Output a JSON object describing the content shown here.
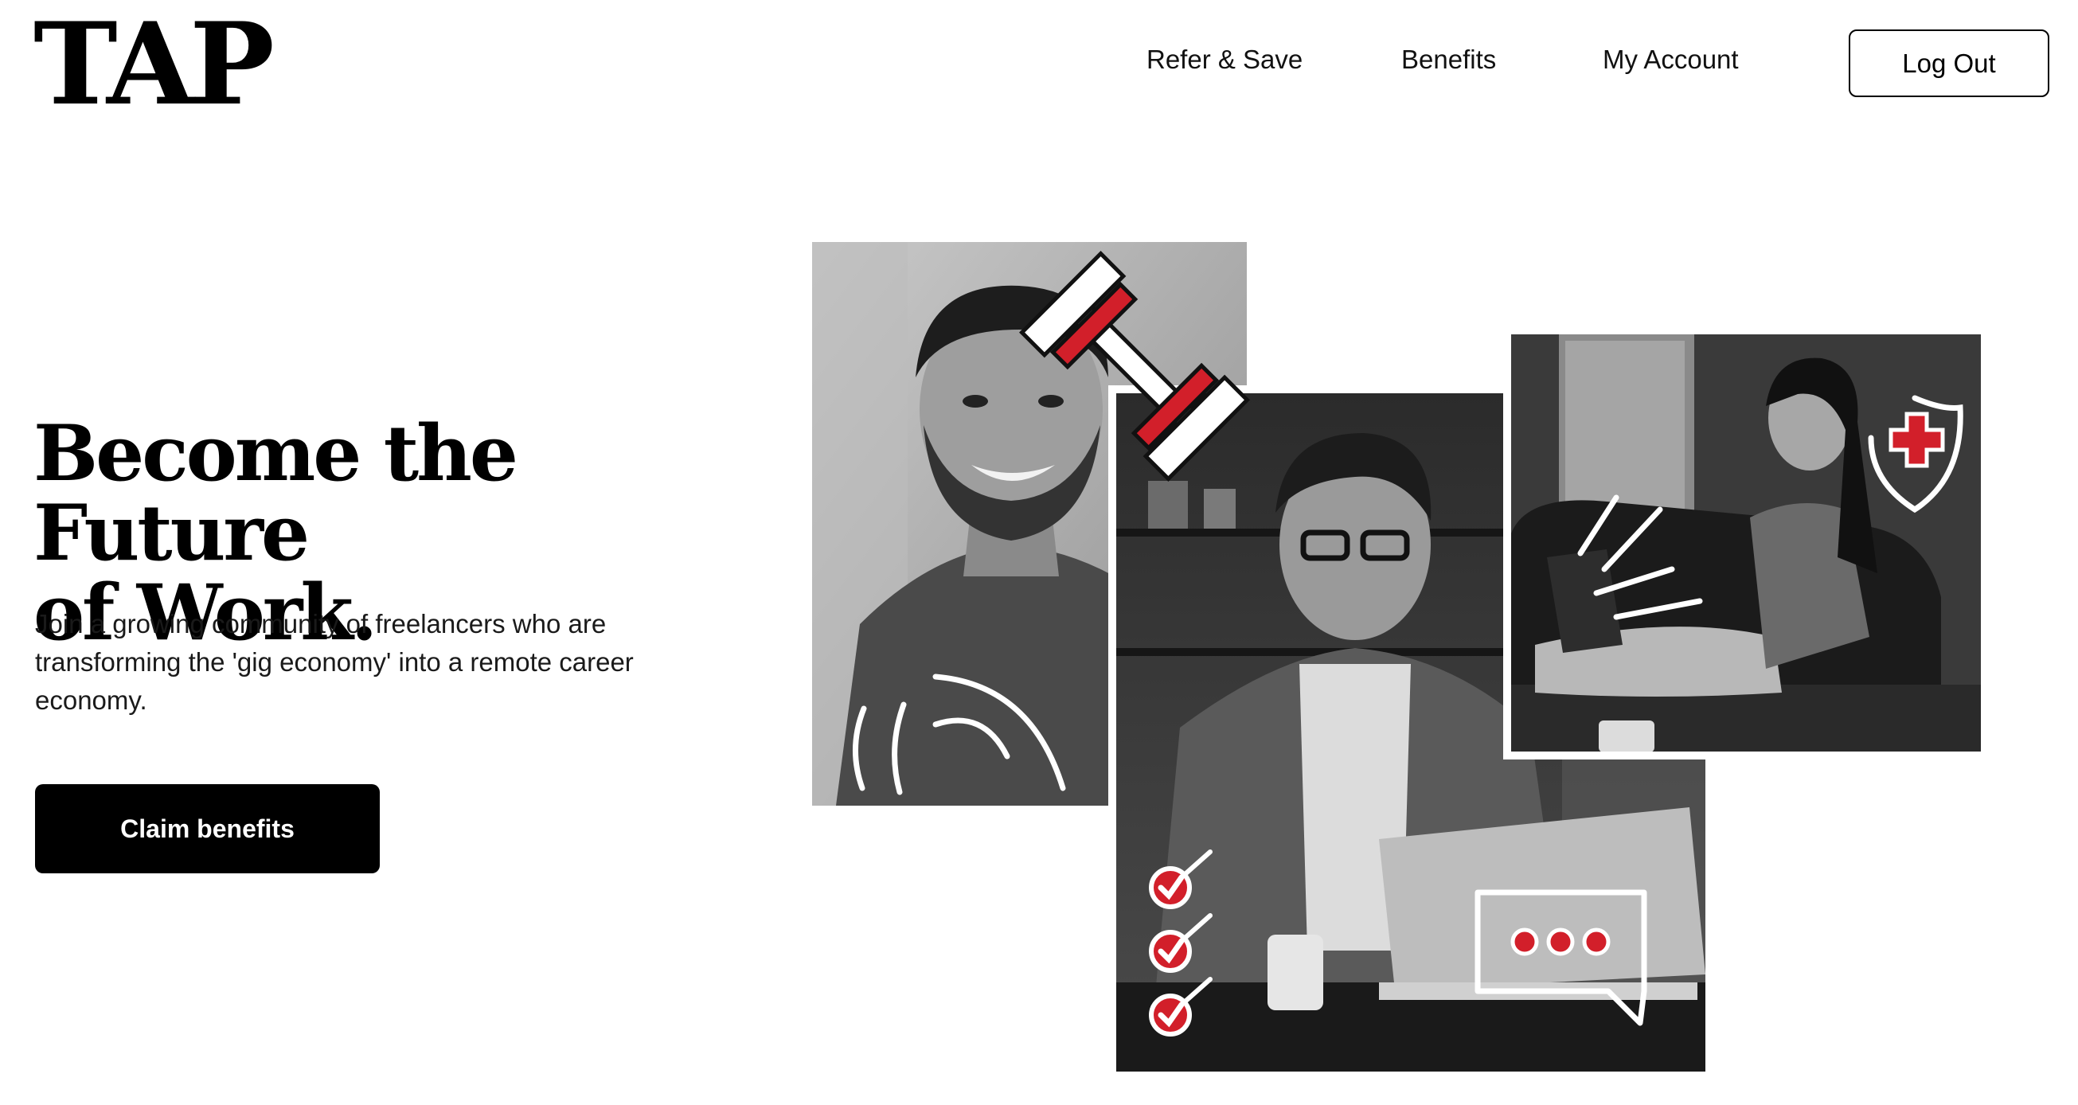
{
  "header": {
    "logo": "TAP",
    "nav": {
      "refer": "Refer & Save",
      "benefits": "Benefits",
      "account": "My Account"
    },
    "logout_label": "Log Out"
  },
  "hero": {
    "headline_line1": "Become the Future",
    "headline_line2": "of Work.",
    "subhead": "Join a growing community of freelancers who are transforming the 'gig economy' into a remote career economy.",
    "cta_label": "Claim benefits"
  },
  "colors": {
    "accent": "#d21f2a",
    "text": "#000000",
    "background": "#ffffff"
  },
  "collage": {
    "photos": [
      "smiling-man-photo",
      "man-on-laptop-photo",
      "woman-on-couch-photo"
    ],
    "stickers": [
      "dumbbell-icon",
      "signal-arcs-icon",
      "checklist-icon",
      "chat-bubble-icon",
      "health-shield-icon",
      "sparkle-lines-icon"
    ]
  }
}
